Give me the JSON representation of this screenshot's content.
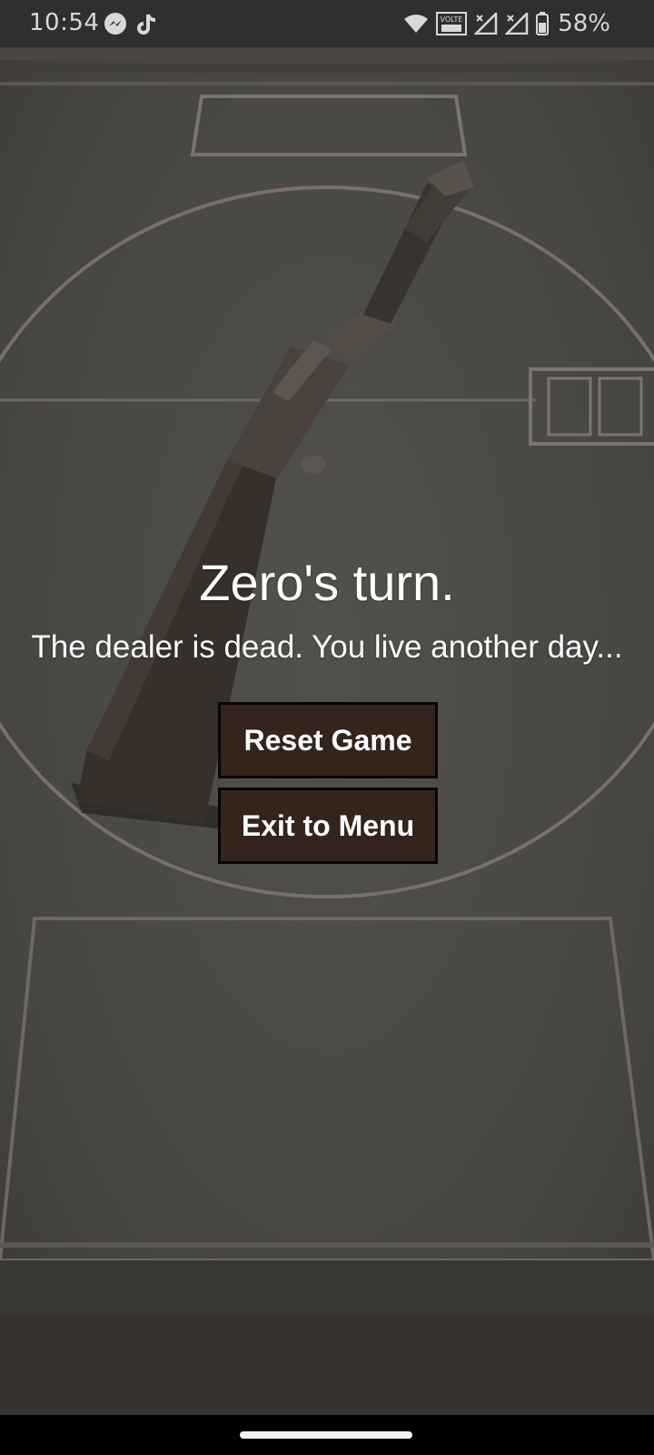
{
  "status_bar": {
    "time": "10:54",
    "battery_percent": "58%",
    "network_badge": "VOLTE",
    "icons": [
      "messenger-icon",
      "tiktok-icon",
      "wifi-icon",
      "volte-icon",
      "signal-icon",
      "signal-icon",
      "battery-icon"
    ]
  },
  "game": {
    "turn_title": "Zero's turn.",
    "subtitle": "The dealer is dead. You live another day...",
    "buttons": {
      "reset": "Reset Game",
      "exit": "Exit to Menu"
    }
  },
  "colors": {
    "table": "#555450",
    "button_bg": "#33241c",
    "button_border": "#080605",
    "text": "#ffffff"
  }
}
